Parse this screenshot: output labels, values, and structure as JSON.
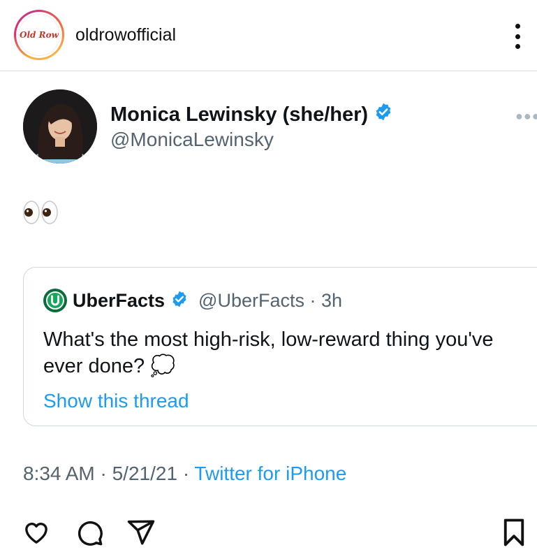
{
  "post": {
    "username": "oldrowofficial",
    "logo_text": "Old Row"
  },
  "tweet": {
    "name": "Monica Lewinsky (she/her)",
    "handle": "@MonicaLewinsky",
    "body": "👀",
    "quote": {
      "name": "UberFacts",
      "handle_time": "@UberFacts · 3h",
      "text": "What's the most high-risk, low-reward thing you've ever done? 💭",
      "link": "Show this thread"
    },
    "timestamp": "8:34 AM · 5/21/21 · ",
    "source": "Twitter for iPhone"
  },
  "icons": {
    "verified": "verified-badge-icon",
    "like": "heart-icon",
    "comment": "comment-icon",
    "share": "share-icon",
    "save": "bookmark-icon",
    "more": "more-vertical-icon"
  },
  "colors": {
    "twitter_blue": "#1d9bf0",
    "verified": "#1d9bf0",
    "secondary_text": "#536471"
  }
}
